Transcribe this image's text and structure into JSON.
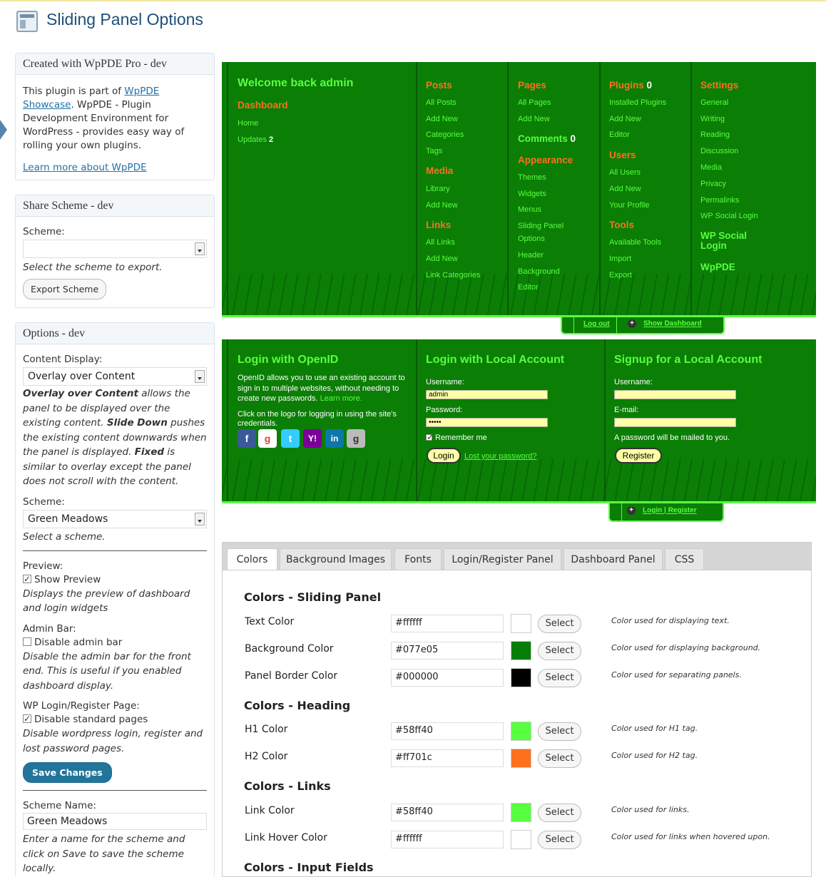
{
  "page": {
    "title": "Sliding Panel Options"
  },
  "sidebar": {
    "created": {
      "title": "Created with WpPDE Pro - dev",
      "text_pre": "This plugin is part of",
      "link_wppde": "WpPDE Showcase",
      "text_post": ". WpPDE - Plugin Development Environment for WordPress - provides easy way of rolling your own plugins.",
      "learn_more": "Learn more about WpPDE"
    },
    "share": {
      "title": "Share Scheme - dev",
      "scheme_label": "Scheme:",
      "scheme_value": "",
      "help": "Select the scheme to export.",
      "export_button": "Export Scheme"
    },
    "options": {
      "title": "Options - dev",
      "content_display_label": "Content Display:",
      "content_display_value": "Overlay over Content",
      "content_display_help_1": "Overlay over Content",
      "content_display_help_2": " allows the panel to be displayed over the existing content. ",
      "content_display_help_3": "Slide Down",
      "content_display_help_4": " pushes the existing content downwards when the panel is displayed. ",
      "content_display_help_5": "Fixed",
      "content_display_help_6": " is similar to overlay except the panel does not scroll with the content.",
      "scheme_label": "Scheme:",
      "scheme_value": "Green Meadows",
      "scheme_help": "Select a scheme.",
      "preview_label": "Preview:",
      "preview_check": "Show Preview",
      "preview_help": "Displays the preview of dashboard and login widgets",
      "adminbar_label": "Admin Bar:",
      "adminbar_check": "Disable admin bar",
      "adminbar_help": "Disable the admin bar for the front end. This is useful if you enabled dashboard display.",
      "wplogin_label": "WP Login/Register Page:",
      "wplogin_check": "Disable standard pages",
      "wplogin_help": "Disable wordpress login, register and lost password pages.",
      "save_button": "Save Changes",
      "scheme_name_label": "Scheme Name:",
      "scheme_name_value": "Green Meadows",
      "scheme_name_help": "Enter a name for the scheme and click on Save to save the scheme locally."
    }
  },
  "dashboard": {
    "welcome": "Welcome back admin",
    "dashboard_h": "Dashboard",
    "home": "Home",
    "updates": "Updates",
    "updates_count": "2",
    "posts_h": "Posts",
    "posts": [
      "All Posts",
      "Add New",
      "Categories",
      "Tags"
    ],
    "media_h": "Media",
    "media": [
      "Library",
      "Add New"
    ],
    "links_h": "Links",
    "links": [
      "All Links",
      "Add New",
      "Link Categories"
    ],
    "pages_h": "Pages",
    "pages": [
      "All Pages",
      "Add New"
    ],
    "comments_h": "Comments",
    "comments_count": "0",
    "appearance_h": "Appearance",
    "appearance": [
      "Themes",
      "Widgets",
      "Menus",
      "Sliding Panel",
      "Options",
      "Header",
      "Background",
      "Editor"
    ],
    "plugins_h": "Plugins",
    "plugins_count": "0",
    "plugins": [
      "Installed Plugins",
      "Add New",
      "Editor"
    ],
    "users_h": "Users",
    "users": [
      "All Users",
      "Add New",
      "Your Profile"
    ],
    "tools_h": "Tools",
    "tools": [
      "Available Tools",
      "Import",
      "Export"
    ],
    "settings_h": "Settings",
    "settings": [
      "General",
      "Writing",
      "Reading",
      "Discussion",
      "Media",
      "Privacy",
      "Permalinks",
      "WP Social Login"
    ],
    "social_h": "WP Social Login",
    "wppde_h": "WpPDE",
    "logout": "Log out",
    "show_dashboard": "Show Dashboard"
  },
  "login": {
    "openid_h": "Login with OpenID",
    "openid_text": "OpenID allows you to use an existing account to sign in to multiple websites, without needing to create new passwords.",
    "learn_more": "Learn more.",
    "click_text": "Click on the logo for logging in using the site's credentials.",
    "local_h": "Login with Local Account",
    "username_label": "Username:",
    "username_value": "admin",
    "password_label": "Password:",
    "password_value": "•••••",
    "remember": "Remember me",
    "login_btn": "Login",
    "lost": "Lost your password?",
    "signup_h": "Signup for a Local Account",
    "su_username_label": "Username:",
    "su_email_label": "E-mail:",
    "su_note": "A password will be mailed to you.",
    "register_btn": "Register",
    "login_register": "Login | Register"
  },
  "tabs": [
    "Colors",
    "Background Images",
    "Fonts",
    "Login/Register Panel",
    "Dashboard Panel",
    "CSS"
  ],
  "colors": {
    "sliding_h": "Colors - Sliding Panel",
    "heading_h": "Colors - Heading",
    "links_h": "Colors - Links",
    "input_h": "Colors - Input Fields",
    "select_label": "Select",
    "rows": [
      {
        "label": "Text Color",
        "value": "#ffffff",
        "desc": "Color used for displaying text."
      },
      {
        "label": "Background Color",
        "value": "#077e05",
        "desc": "Color used for displaying background."
      },
      {
        "label": "Panel Border Color",
        "value": "#000000",
        "desc": "Color used for separating panels."
      },
      {
        "label": "H1 Color",
        "value": "#58ff40",
        "desc": "Color used for H1 tag."
      },
      {
        "label": "H2 Color",
        "value": "#ff701c",
        "desc": "Color used for H2 tag."
      },
      {
        "label": "Link Color",
        "value": "#58ff40",
        "desc": "Color used for links."
      },
      {
        "label": "Link Hover Color",
        "value": "#ffffff",
        "desc": "Color used for links when hovered upon."
      }
    ]
  }
}
